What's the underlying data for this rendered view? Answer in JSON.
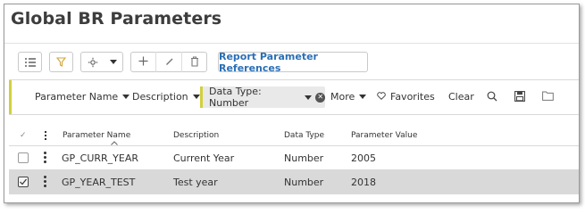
{
  "page": {
    "title": "Global BR Parameters"
  },
  "toolbar": {
    "report_button_label": "Report Parameter References",
    "icons": [
      "list-icon",
      "filter-icon",
      "settings-dropdown-icon",
      "add-icon",
      "edit-icon",
      "delete-icon"
    ]
  },
  "filter_bar": {
    "parameter_name_label": "Parameter Name",
    "description_label": "Description",
    "data_type_chip": "Data Type: Number",
    "more_label": "More",
    "favorites_label": "Favorites",
    "clear_label": "Clear",
    "accent_color": "#d2cf3c"
  },
  "grid": {
    "columns": {
      "parameter_name": "Parameter Name",
      "description": "Description",
      "data_type": "Data Type",
      "parameter_value": "Parameter Value"
    },
    "rows": [
      {
        "parameter_name": "GP_CURR_YEAR",
        "description": "Current Year",
        "data_type": "Number",
        "parameter_value": "2005",
        "selected": false
      },
      {
        "parameter_name": "GP_YEAR_TEST",
        "description": "Test year",
        "data_type": "Number",
        "parameter_value": "2018",
        "selected": true
      }
    ],
    "selected_row_color": "#d9d9d9"
  }
}
